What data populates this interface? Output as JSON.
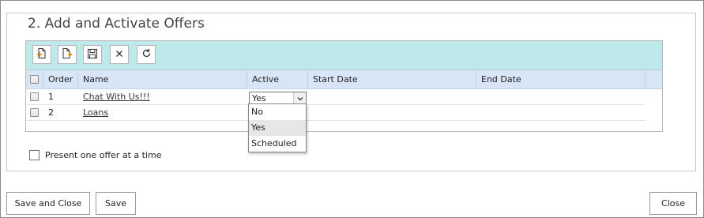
{
  "section": {
    "title": "2. Add and Activate Offers"
  },
  "toolbar": {
    "buttons": [
      {
        "icon": "add-page-icon"
      },
      {
        "icon": "add-page-arrow-icon"
      },
      {
        "icon": "save-icon"
      },
      {
        "icon": "close-icon"
      },
      {
        "icon": "refresh-icon"
      }
    ]
  },
  "grid": {
    "columns": [
      "Order",
      "Name",
      "Active",
      "Start Date",
      "End Date"
    ],
    "rows": [
      {
        "order": "1",
        "name": "Chat With Us!!!",
        "active": "Yes",
        "start_date": "",
        "end_date": ""
      },
      {
        "order": "2",
        "name": "Loans",
        "active": "",
        "start_date": "",
        "end_date": ""
      }
    ]
  },
  "active_dropdown": {
    "options": [
      "No",
      "Yes",
      "Scheduled"
    ],
    "highlighted": "Yes"
  },
  "present_one_offer": {
    "label": "Present one offer at a time",
    "checked": false
  },
  "footer": {
    "save_and_close": "Save and Close",
    "save": "Save",
    "close": "Close"
  },
  "colors": {
    "toolbar_bg": "#bfe8eb",
    "header_bg": "#d7e5f6"
  }
}
